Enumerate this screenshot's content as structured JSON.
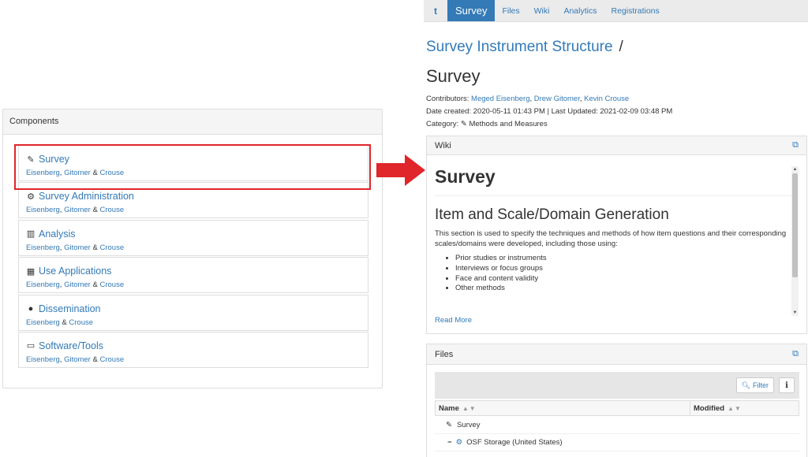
{
  "components": {
    "header": "Components",
    "items": [
      {
        "icon": "pencil-icon",
        "title": "Survey",
        "contributors": [
          {
            "name": "Eisenberg",
            "link": true
          },
          {
            "text": ", "
          },
          {
            "name": "Gitomer",
            "link": true
          },
          {
            "text": " & "
          },
          {
            "name": "Crouse",
            "link": true
          }
        ]
      },
      {
        "icon": "cogs-icon",
        "title": "Survey Administration",
        "contributors": [
          {
            "name": "Eisenberg",
            "link": true
          },
          {
            "text": ", "
          },
          {
            "name": "Gitomer",
            "link": true
          },
          {
            "text": " & "
          },
          {
            "name": "Crouse",
            "link": true
          }
        ]
      },
      {
        "icon": "bar-chart-icon",
        "title": "Analysis",
        "contributors": [
          {
            "name": "Eisenberg",
            "link": true
          },
          {
            "text": ", "
          },
          {
            "name": "Gitomer",
            "link": true
          },
          {
            "text": " & "
          },
          {
            "name": "Crouse",
            "link": true
          }
        ]
      },
      {
        "icon": "grid-icon",
        "title": "Use Applications",
        "contributors": [
          {
            "name": "Eisenberg",
            "link": true
          },
          {
            "text": ", "
          },
          {
            "name": "Gitomer",
            "link": true
          },
          {
            "text": " & "
          },
          {
            "name": "Crouse",
            "link": true
          }
        ]
      },
      {
        "icon": "speech-bubble-icon",
        "title": "Dissemination",
        "contributors": [
          {
            "name": "Eisenberg",
            "link": true
          },
          {
            "text": " & "
          },
          {
            "name": "Crouse",
            "link": true
          }
        ]
      },
      {
        "icon": "laptop-icon",
        "title": "Software/Tools",
        "contributors": [
          {
            "name": "Eisenberg",
            "link": true
          },
          {
            "text": ", "
          },
          {
            "name": "Gitomer",
            "link": true
          },
          {
            "text": " & "
          },
          {
            "name": "Crouse",
            "link": true
          }
        ]
      }
    ]
  },
  "nav": {
    "logo": "t",
    "items": [
      "Survey",
      "Files",
      "Wiki",
      "Analytics",
      "Registrations"
    ],
    "active": "Survey"
  },
  "project": {
    "parent_title": "Survey Instrument Structure",
    "separator": "/",
    "component_title": "Survey",
    "contributors_label": "Contributors:",
    "contributors": [
      "Meged Eisenberg",
      "Drew Gitomer",
      "Kevin Crouse"
    ],
    "dates": "Date created: 2020-05-11 01:43 PM | Last Updated: 2021-02-09 03:48 PM",
    "category_label": "Category:",
    "category": "Methods and Measures"
  },
  "wiki": {
    "header": "Wiki",
    "h1": "Survey",
    "h2": "Item and Scale/Domain Generation",
    "paragraph": "This section is used to specify the techniques and methods of how item questions and their corresponding scales/domains were developed, including those using:",
    "bullets": [
      "Prior studies or instruments",
      "Interviews or focus groups",
      "Face and content validity",
      "Other methods"
    ],
    "read_more": "Read More"
  },
  "files": {
    "header": "Files",
    "filter_label": "Filter",
    "info_label": "i",
    "col_name": "Name",
    "col_modified": "Modified",
    "rows": [
      "Survey",
      "OSF Storage (United States)"
    ],
    "collapse_symbol": "−"
  },
  "colors": {
    "link": "#337ab7",
    "highlight": "#e0252b",
    "nav_active": "#337ab7"
  }
}
